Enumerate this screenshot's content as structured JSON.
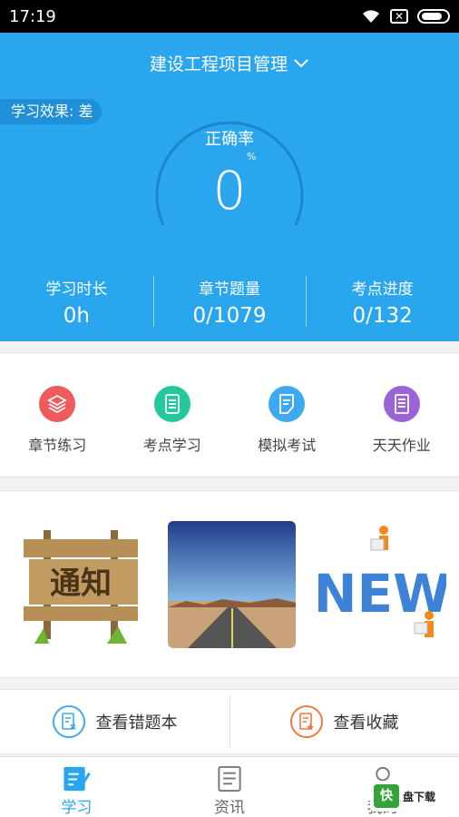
{
  "status_bar": {
    "time": "17:19"
  },
  "header": {
    "project_title": "建设工程项目管理",
    "effect_badge": "学习效果: 差",
    "gauge": {
      "label": "正确率",
      "percent_sign": "%",
      "value": "0"
    },
    "stats": [
      {
        "label": "学习时长",
        "value": "0h"
      },
      {
        "label": "章节题量",
        "value": "0/1079"
      },
      {
        "label": "考点进度",
        "value": "0/132"
      }
    ]
  },
  "menu": [
    {
      "label": "章节练习",
      "icon": "layers-icon",
      "color": "#ef5a5a"
    },
    {
      "label": "考点学习",
      "icon": "document-icon",
      "color": "#26c79b"
    },
    {
      "label": "模拟考试",
      "icon": "exam-icon",
      "color": "#3ea9f0"
    },
    {
      "label": "天天作业",
      "icon": "homework-icon",
      "color": "#9a63d8"
    }
  ],
  "banners": [
    {
      "name": "notice-banner",
      "text": "通知"
    },
    {
      "name": "road-banner"
    },
    {
      "name": "news-banner",
      "text": "NEW"
    }
  ],
  "actions": [
    {
      "label": "查看错题本",
      "icon": "wrong-book-icon",
      "color": "#3ea9f0"
    },
    {
      "label": "查看收藏",
      "icon": "favorite-icon",
      "color": "#ef7a3c"
    }
  ],
  "tabs": [
    {
      "label": "学习",
      "icon": "study-icon",
      "active": true
    },
    {
      "label": "资讯",
      "icon": "news-icon",
      "active": false
    },
    {
      "label": "我的",
      "icon": "profile-icon",
      "active": false
    }
  ],
  "watermark": {
    "badge": "快",
    "text": "盘下载"
  },
  "colors": {
    "primary": "#2aa6ef",
    "badge_bg": "#1f8fd8"
  }
}
